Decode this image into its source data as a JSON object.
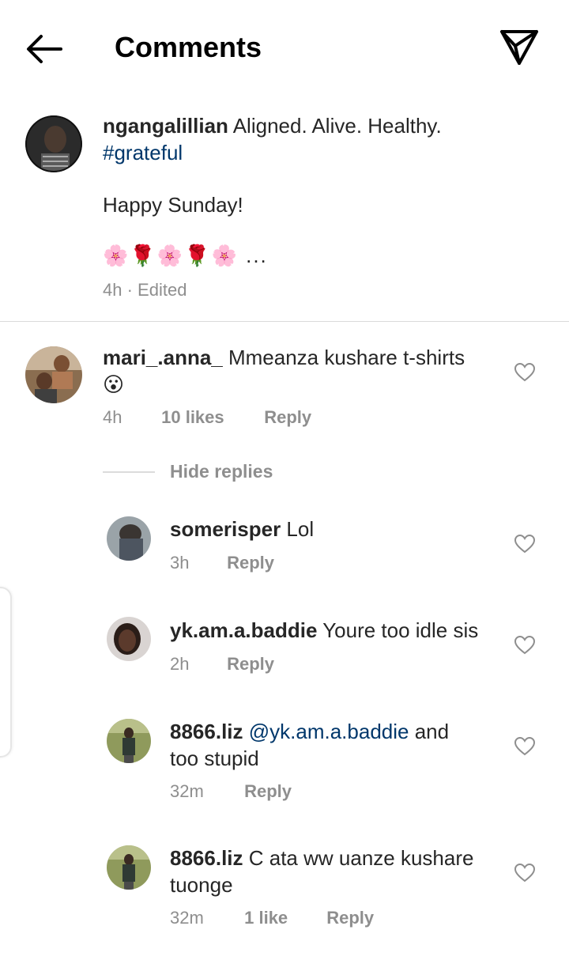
{
  "header": {
    "title": "Comments"
  },
  "caption": {
    "username": "ngangalillian",
    "text": "Aligned. Alive. Healthy.",
    "hashtag": "#grateful",
    "line2": "Happy Sunday!",
    "emoji_line": "🌸🌹🌸🌹🌸 ...",
    "time": "4h",
    "edited": "· Edited"
  },
  "comments": [
    {
      "username": "mari_.anna_",
      "text": "Mmeanza kushare t-shirts",
      "text2": "😮",
      "time": "4h",
      "likes": "10 likes",
      "reply_label": "Reply"
    }
  ],
  "hide_replies_label": "Hide replies",
  "replies": [
    {
      "username": "somerisper",
      "text": "Lol",
      "time": "3h",
      "reply_label": "Reply"
    },
    {
      "username": "yk.am.a.baddie",
      "text": "Youre too idle sis",
      "time": "2h",
      "reply_label": "Reply"
    },
    {
      "username": "8866.liz",
      "mention": "@yk.am.a.baddie",
      "text": "and",
      "text2": "too stupid",
      "time": "32m",
      "reply_label": "Reply"
    },
    {
      "username": "8866.liz",
      "text": "C ata ww uanze kushare",
      "text2": "tuonge",
      "time": "32m",
      "likes": "1 like",
      "reply_label": "Reply"
    }
  ],
  "colors": {
    "link": "#00376b",
    "muted": "#8e8e8e",
    "divider": "#dbdbdb",
    "text": "#262626"
  },
  "icons": [
    "back-arrow-icon",
    "direct-message-icon",
    "heart-icon"
  ]
}
